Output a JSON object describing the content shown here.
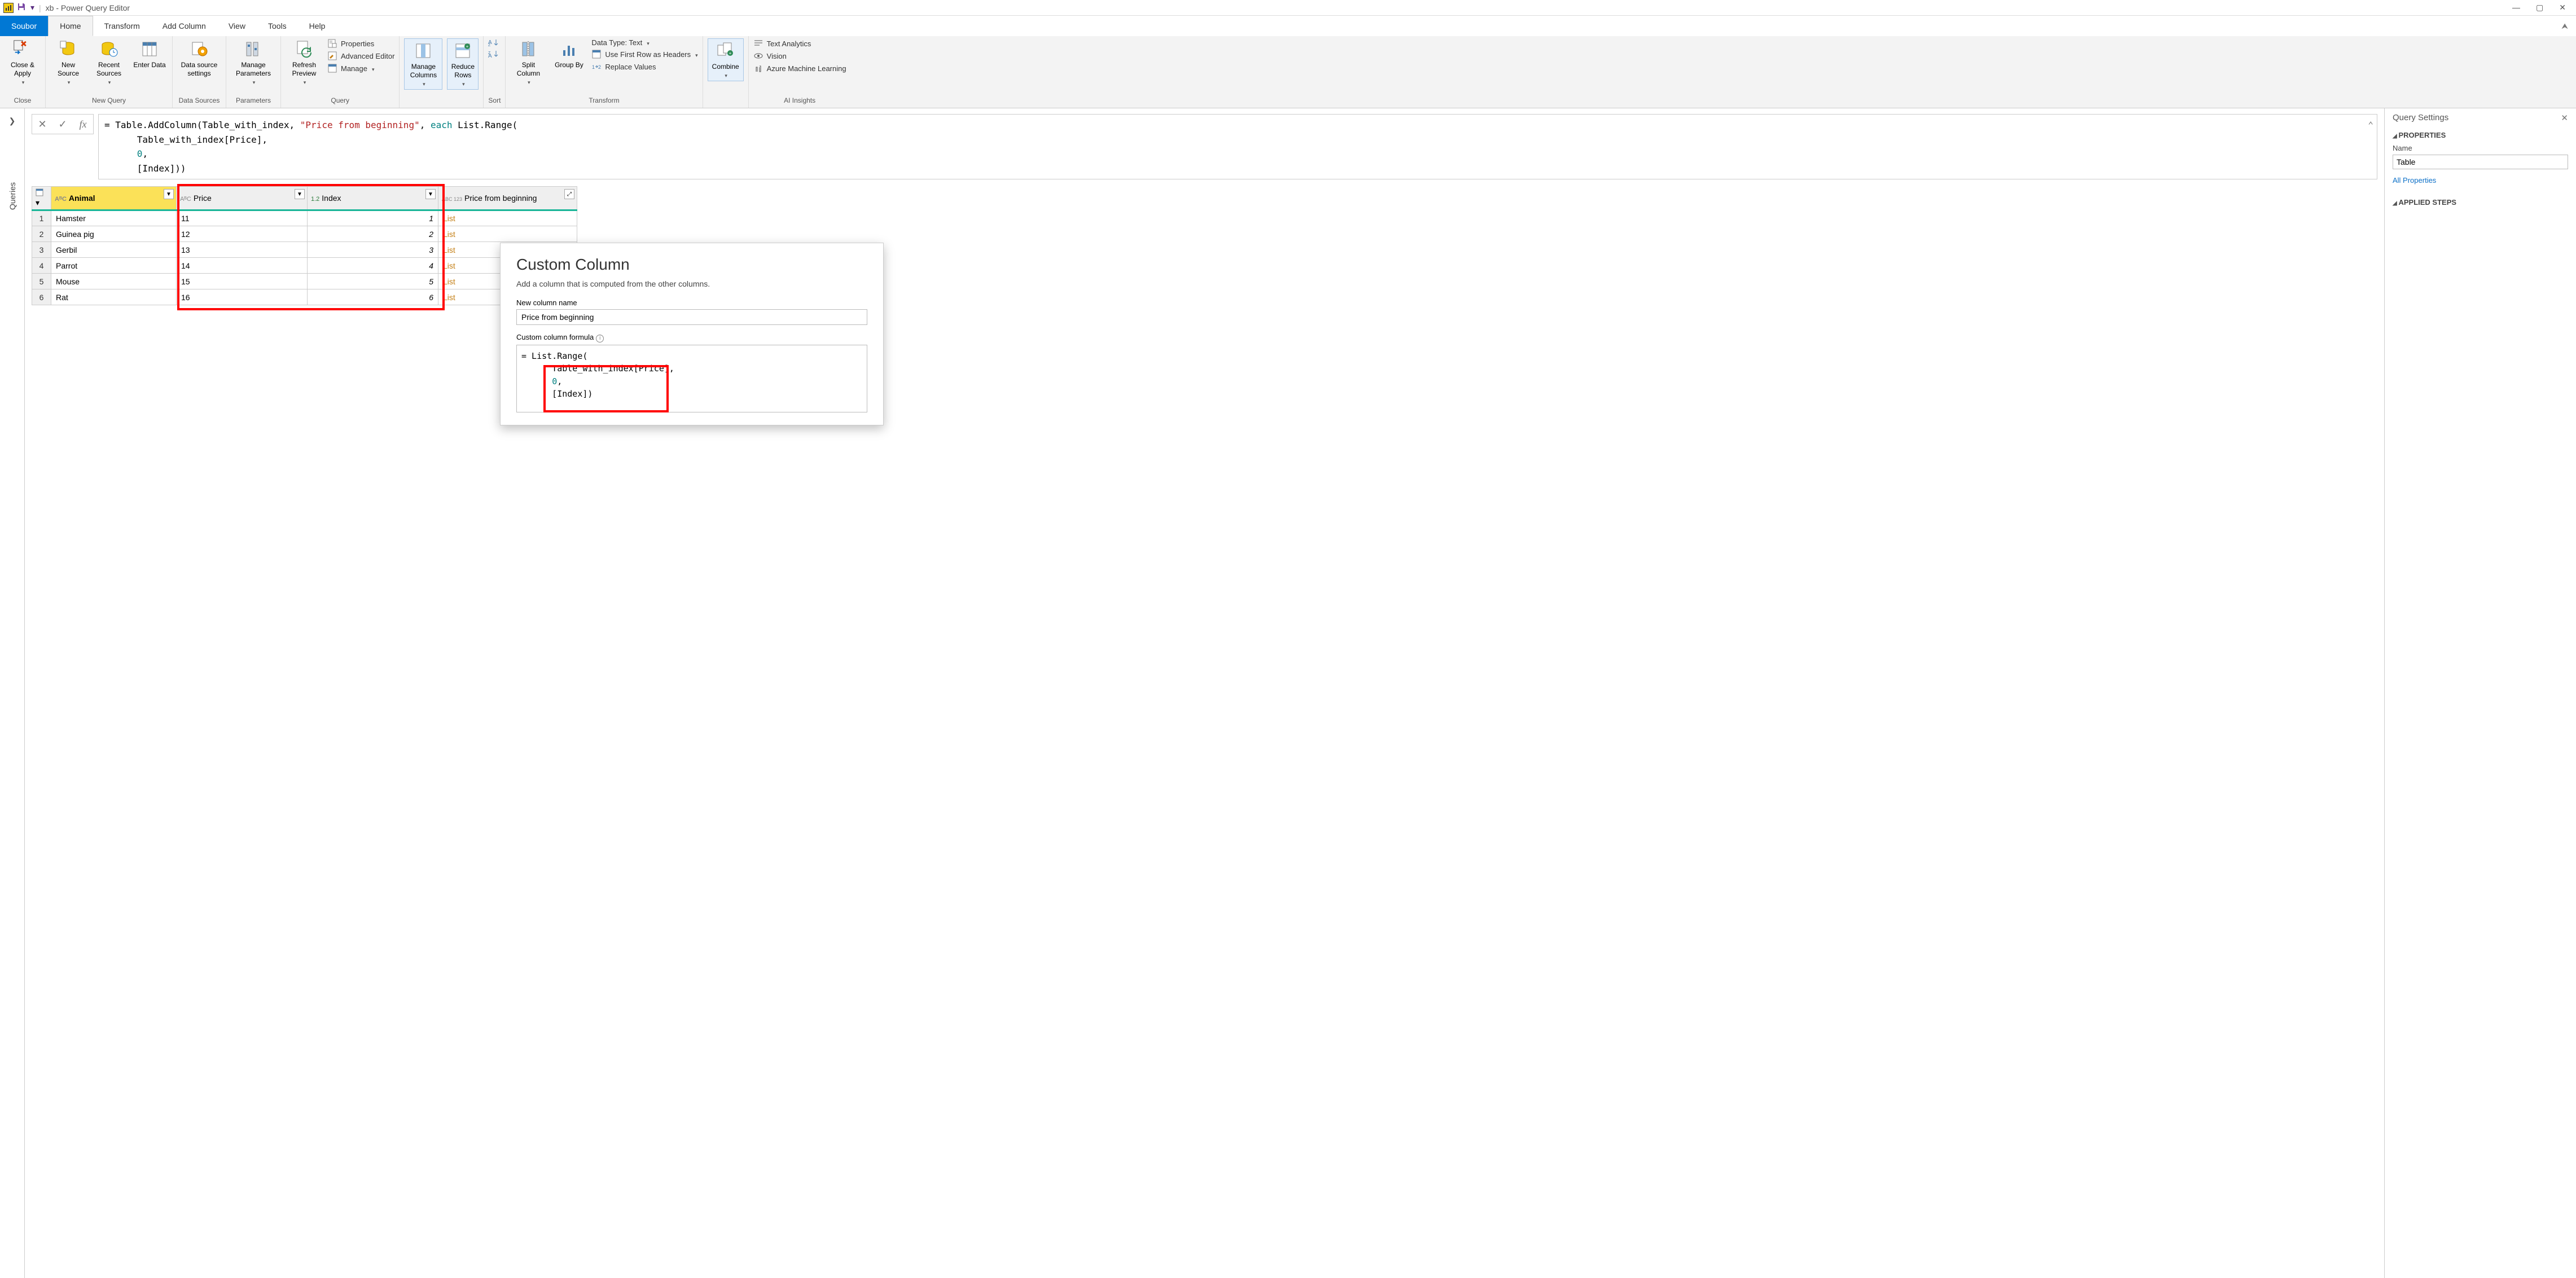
{
  "titlebar": {
    "title": "xb - Power Query Editor",
    "qat_down": "▾",
    "qat_sep": "|"
  },
  "win_controls": {
    "min": "—",
    "max": "▢",
    "close": "✕"
  },
  "menu": {
    "file": "Soubor",
    "tabs": [
      "Home",
      "Transform",
      "Add Column",
      "View",
      "Tools",
      "Help"
    ],
    "active_index": 0,
    "collapse": "⮝"
  },
  "ribbon": {
    "groups": {
      "close": {
        "label": "Close",
        "close_apply": "Close &\nApply"
      },
      "newquery": {
        "label": "New Query",
        "new_source": "New\nSource",
        "recent_sources": "Recent\nSources",
        "enter_data": "Enter\nData"
      },
      "data_sources": {
        "label": "Data Sources",
        "data_source_settings": "Data source\nsettings"
      },
      "parameters": {
        "label": "Parameters",
        "manage_parameters": "Manage\nParameters"
      },
      "query": {
        "label": "Query",
        "refresh_preview": "Refresh\nPreview",
        "properties": "Properties",
        "advanced_editor": "Advanced Editor",
        "manage": "Manage"
      },
      "columns_rows": {
        "manage_columns": "Manage\nColumns",
        "reduce_rows": "Reduce\nRows"
      },
      "sort": {
        "label": "Sort"
      },
      "transform": {
        "label": "Transform",
        "split_column": "Split\nColumn",
        "group_by": "Group\nBy",
        "data_type": "Data Type: Text",
        "first_row_headers": "Use First Row as Headers",
        "replace_values": "Replace Values"
      },
      "combine": {
        "combine": "Combine"
      },
      "ai": {
        "label": "AI Insights",
        "text_analytics": "Text Analytics",
        "vision": "Vision",
        "aml": "Azure Machine Learning"
      }
    }
  },
  "side": {
    "expand": "❯",
    "queries_label": "Queries"
  },
  "formula_bar": {
    "cancel": "✕",
    "confirm": "✓",
    "fx": "fx",
    "expand": "⌃"
  },
  "formula": {
    "line1_a": "= Table.AddColumn(Table_with_index, ",
    "line1_str": "\"Price from beginning\"",
    "line1_b": ", ",
    "line1_kw": "each",
    "line1_c": " List.Range(",
    "line2": "      Table_with_index[Price],",
    "line3_a": "      ",
    "line3_num": "0",
    "line3_b": ",",
    "line4": "      [Index]))"
  },
  "table": {
    "columns": [
      {
        "type": "AᴮC",
        "name": "Animal",
        "selected": true
      },
      {
        "type": "AᴮC",
        "name": "Price"
      },
      {
        "type": "1.2",
        "name": "Index"
      },
      {
        "type": "ABC\n123",
        "name": "Price from beginning"
      }
    ],
    "rows": [
      {
        "n": 1,
        "animal": "Hamster",
        "price": "11",
        "index": "1",
        "list": "List"
      },
      {
        "n": 2,
        "animal": "Guinea pig",
        "price": "12",
        "index": "2",
        "list": "List"
      },
      {
        "n": 3,
        "animal": "Gerbil",
        "price": "13",
        "index": "3",
        "list": "List"
      },
      {
        "n": 4,
        "animal": "Parrot",
        "price": "14",
        "index": "4",
        "list": "List"
      },
      {
        "n": 5,
        "animal": "Mouse",
        "price": "15",
        "index": "5",
        "list": "List"
      },
      {
        "n": 6,
        "animal": "Rat",
        "price": "16",
        "index": "6",
        "list": "List"
      }
    ],
    "expand_icon": "⤢"
  },
  "query_settings": {
    "title": "Query Settings",
    "close": "✕",
    "properties_label": "PROPERTIES",
    "name_label": "Name",
    "name_value": "Table",
    "all_properties": "All Properties",
    "applied_steps_label": "APPLIED STEPS"
  },
  "popup": {
    "title": "Custom Column",
    "subtitle": "Add a column that is computed from the other columns.",
    "new_col_label": "New column name",
    "new_col_value": "Price from beginning",
    "formula_label": "Custom column formula",
    "info": "i",
    "formula_line1": "= List.Range(",
    "formula_line2": "      Table_with_index[Price],",
    "formula_line3_a": "      ",
    "formula_line3_num": "0",
    "formula_line3_b": ",",
    "formula_line4": "      [Index])"
  }
}
